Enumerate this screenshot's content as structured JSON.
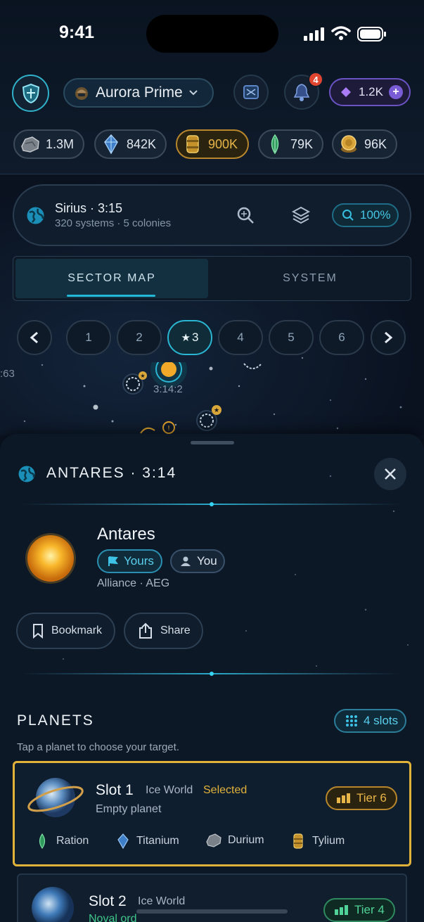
{
  "status": {
    "time": "9:41"
  },
  "header": {
    "account_name": "Aurora Prime",
    "notifications_count": "4",
    "premium_amount": "1.2K",
    "resources": [
      {
        "name": "Durium",
        "value": "1.3M",
        "icon": "rock-icon",
        "highlight": false
      },
      {
        "name": "Titanium",
        "value": "842K",
        "icon": "crystal-icon",
        "highlight": false
      },
      {
        "name": "Tylium",
        "value": "900K",
        "icon": "barrel-icon",
        "highlight": true
      },
      {
        "name": "Ration",
        "value": "79K",
        "icon": "leaf-icon",
        "highlight": false
      },
      {
        "name": "Credits",
        "value": "96K",
        "icon": "coin-icon",
        "highlight": false
      }
    ]
  },
  "location": {
    "title": "Sirius · 3:15",
    "subtitle": "320 systems · 5 colonies",
    "zoom": "100%"
  },
  "tabs": [
    {
      "label": "SECTOR MAP",
      "active": true
    },
    {
      "label": "SYSTEM",
      "active": false
    }
  ],
  "pagination": {
    "pages": [
      "1",
      "2",
      "3",
      "4",
      "5",
      "6"
    ],
    "active_index": 2
  },
  "map": {
    "left_label": ":63",
    "system_label": "3:14:2"
  },
  "sheet": {
    "header": "ANTARES · 3:14",
    "star": {
      "name": "Antares",
      "tag_owner": "Yours",
      "tag_user": "You",
      "alliance": "Alliance · AEG"
    },
    "actions": {
      "bookmark": "Bookmark",
      "share": "Share"
    },
    "planets": {
      "title": "PLANETS",
      "slots": "4 slots",
      "hint": "Tap a planet to choose your target.",
      "items": [
        {
          "slot": "Slot 1",
          "type": "Ice World",
          "status": "Selected",
          "desc": "Empty planet",
          "tier": "Tier 6",
          "resources": [
            "Ration",
            "Titanium",
            "Durium",
            "Tylium"
          ]
        },
        {
          "slot": "Slot 2",
          "type": "Ice World",
          "status": "",
          "desc": "Noval ord",
          "tier": "Tier 4",
          "resources": []
        }
      ]
    }
  },
  "colors": {
    "accent": "#22b8d6",
    "gold": "#e0b23a",
    "green": "#3ec78a",
    "purple": "#7a5cd6",
    "badge": "#e0452f"
  }
}
